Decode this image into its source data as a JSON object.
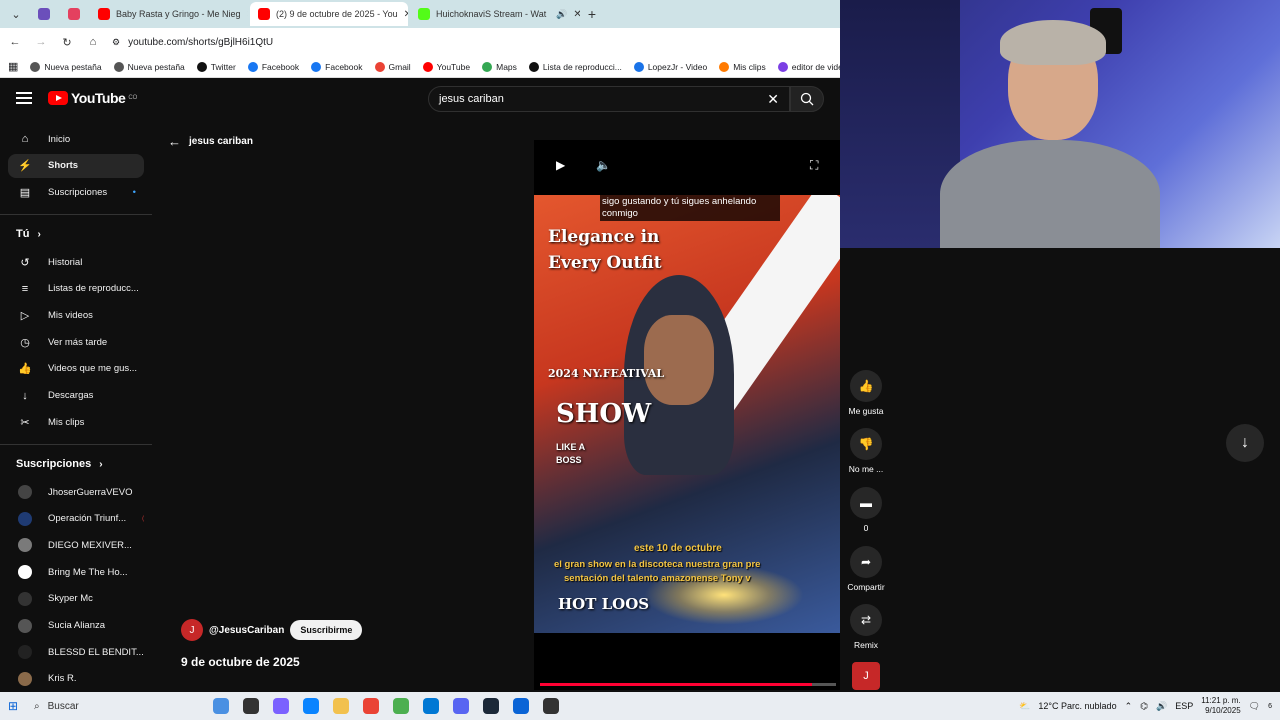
{
  "browser": {
    "tabs": [
      {
        "label": "",
        "color": "#6b4fbb"
      },
      {
        "label": "",
        "color": "#e4405f"
      },
      {
        "label": "Baby Rasta y Gringo - Me Nieg",
        "color": "#ff0000"
      },
      {
        "label": "(2) 9 de octubre de 2025 - You",
        "color": "#ff0000"
      },
      {
        "label": "HuichoknaviS Stream - Wat",
        "color": "#53fc18"
      }
    ],
    "new_tab": "+",
    "url": "youtube.com/shorts/gBjlH6i1QtU",
    "bookmarks": [
      {
        "label": "Nueva pestaña",
        "color": "#555"
      },
      {
        "label": "Nueva pestaña",
        "color": "#555"
      },
      {
        "label": "Twitter",
        "color": "#111"
      },
      {
        "label": "Facebook",
        "color": "#1877f2"
      },
      {
        "label": "Facebook",
        "color": "#1877f2"
      },
      {
        "label": "Gmail",
        "color": "#ea4335"
      },
      {
        "label": "YouTube",
        "color": "#ff0000"
      },
      {
        "label": "Maps",
        "color": "#34a853"
      },
      {
        "label": "Lista de reproducci...",
        "color": "#111"
      },
      {
        "label": "LopezJr - Video",
        "color": "#1a73e8"
      },
      {
        "label": "Mis clips",
        "color": "#ff7a00"
      },
      {
        "label": "editor de videos onl",
        "color": "#7b3fe4"
      }
    ]
  },
  "youtube": {
    "logo": "YouTube",
    "logo_sup": "CO",
    "search_query": "jesus cariban",
    "sidebar": {
      "main": [
        {
          "label": "Inicio",
          "icon": "home-icon",
          "glyph": "⌂"
        },
        {
          "label": "Shorts",
          "icon": "shorts-icon",
          "glyph": "⚡"
        },
        {
          "label": "Suscripciones",
          "icon": "subscriptions-icon",
          "glyph": "▤"
        }
      ],
      "you_header": "Tú",
      "you": [
        {
          "label": "Historial",
          "icon": "history-icon",
          "glyph": "↺"
        },
        {
          "label": "Listas de reproducc...",
          "icon": "playlists-icon",
          "glyph": "≡"
        },
        {
          "label": "Mis videos",
          "icon": "my-videos-icon",
          "glyph": "▷"
        },
        {
          "label": "Ver más tarde",
          "icon": "watch-later-icon",
          "glyph": "◷"
        },
        {
          "label": "Videos que me gus...",
          "icon": "liked-icon",
          "glyph": "👍"
        },
        {
          "label": "Descargas",
          "icon": "download-icon",
          "glyph": "↓"
        },
        {
          "label": "Mis clips",
          "icon": "clips-icon",
          "glyph": "✂"
        }
      ],
      "subs_header": "Suscripciones",
      "subs": [
        {
          "label": "JhoserGuerraVEVO",
          "color": "#444",
          "live": false
        },
        {
          "label": "Operación Triunf...",
          "color": "#1f3b73",
          "live": true
        },
        {
          "label": "DIEGO MEXIVER...",
          "color": "#7a7a7a",
          "live": true
        },
        {
          "label": "Bring Me The Ho...",
          "color": "#ffffff",
          "live": true
        },
        {
          "label": "Skyper Mc",
          "color": "#333",
          "live": false
        },
        {
          "label": "Sucia Alianza",
          "color": "#555",
          "live": false
        },
        {
          "label": "BLESSD EL BENDIT...",
          "color": "#222",
          "live": false
        },
        {
          "label": "Kris R.",
          "color": "#8a6a4a",
          "live": false
        }
      ]
    },
    "back_label": "jesus cariban",
    "video": {
      "caption": "sigo gustando y tú sigues anhelando conmigo",
      "overlay": {
        "elegance": "Elegance in",
        "every": "Every Outfit",
        "festival": "2024 NY.FEATIVAL",
        "show": "SHOW",
        "like": "LIKE A",
        "boss": "BOSS",
        "line1": "este 10 de octubre",
        "line2": "el gran show en la discoteca nuestra gran pre",
        "line3": "sentación del talento amazonense Tony v",
        "hot": "HOT LOOS"
      },
      "progress": 0.92
    },
    "channel": {
      "initial": "J",
      "handle": "@JesusCariban",
      "subscribe": "Suscribirme"
    },
    "title": "9 de octubre de 2025",
    "actions": {
      "like": "Me gusta",
      "dislike": "No me ...",
      "comments": "0",
      "share": "Compartir",
      "remix": "Remix",
      "channel_initial": "J"
    }
  },
  "taskbar": {
    "search": "Buscar",
    "weather": "12°C  Parc. nublado",
    "lang": "ESP",
    "time": "11:21 p. m.",
    "date": "9/10/2025",
    "notif": "6",
    "apps": [
      "#4a90e2",
      "#333",
      "#7b61ff",
      "#0a84ff",
      "#f2c14e",
      "#ea4335",
      "#4caf50",
      "#0078d4",
      "#5865f2",
      "#1b2838",
      "#0a64d6",
      "#333"
    ]
  }
}
